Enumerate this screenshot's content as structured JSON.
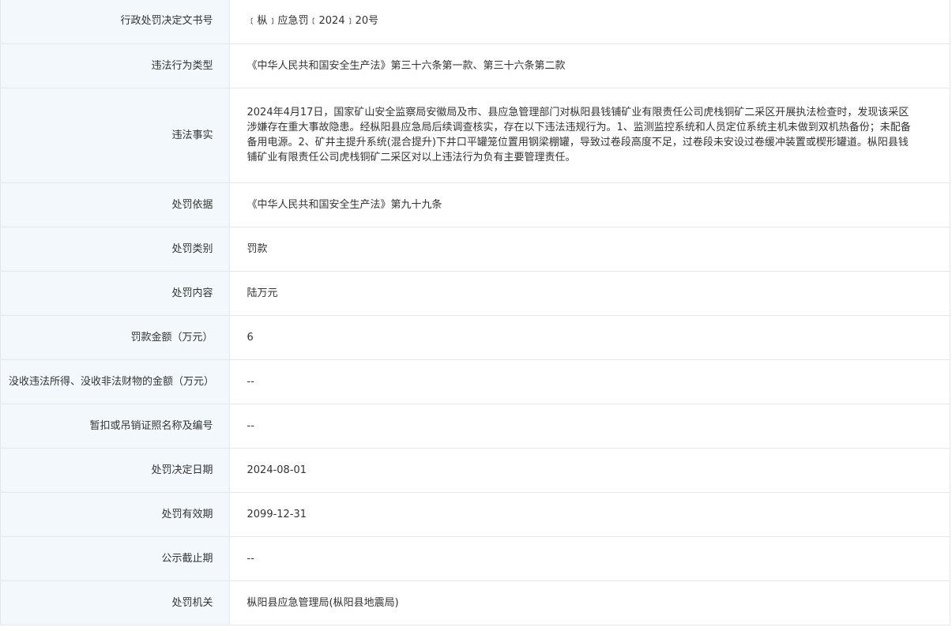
{
  "rows": [
    {
      "label": "行政处罚决定文书号",
      "value": "﹝枞﹞应急罚﹝2024﹞20号"
    },
    {
      "label": "违法行为类型",
      "value": "《中华人民共和国安全生产法》第三十六条第一款、第三十六条第二款"
    },
    {
      "label": "违法事实",
      "value": "2024年4月17日，国家矿山安全监察局安徽局及市、县应急管理部门对枞阳县钱铺矿业有限责任公司虎栈铜矿二采区开展执法检查时，发现该采区涉嫌存在重大事故隐患。经枞阳县应急局后续调查核实，存在以下违法违规行为。1、监测监控系统和人员定位系统主机未做到双机热备份；未配备备用电源。2、矿井主提升系统(混合提升)下井口平罐笼位置用钢梁棚罐，导致过卷段高度不足，过卷段未安设过卷缓冲装置或楔形罐道。枞阳县钱铺矿业有限责任公司虎栈铜矿二采区对以上违法行为负有主要管理责任。"
    },
    {
      "label": "处罚依据",
      "value": "《中华人民共和国安全生产法》第九十九条"
    },
    {
      "label": "处罚类别",
      "value": "罚款"
    },
    {
      "label": "处罚内容",
      "value": "陆万元"
    },
    {
      "label": "罚款金额（万元）",
      "value": "6"
    },
    {
      "label": "没收违法所得、没收非法财物的金额（万元）",
      "value": "--"
    },
    {
      "label": "暂扣或吊销证照名称及编号",
      "value": "--"
    },
    {
      "label": "处罚决定日期",
      "value": "2024-08-01"
    },
    {
      "label": "处罚有效期",
      "value": "2099-12-31"
    },
    {
      "label": "公示截止期",
      "value": "--"
    },
    {
      "label": "处罚机关",
      "value": "枞阳县应急管理局(枞阳县地震局)"
    }
  ]
}
